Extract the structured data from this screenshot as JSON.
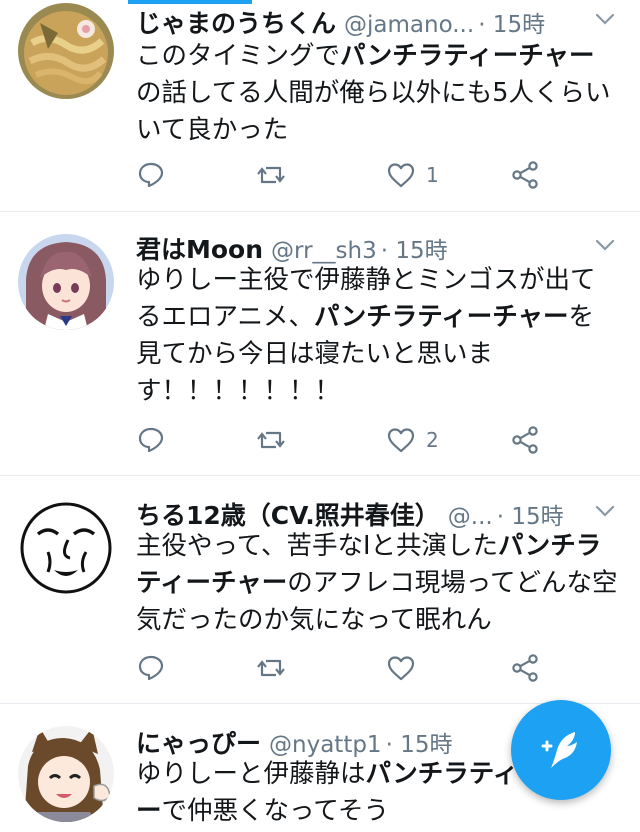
{
  "tweets": [
    {
      "name": "じゃまのうちくん",
      "handle": "@jamano...",
      "time": "· 15時",
      "text": [
        "このタイミングで",
        "パンチラティーチャー",
        "の話してる人間が俺ら以外にも5人くらいいて良かった"
      ],
      "reply_count": "",
      "retweet_count": "",
      "like_count": "1",
      "avatar_icon": "food-bowl-avatar"
    },
    {
      "name": "君はMoon",
      "handle": "@rr__sh3",
      "time": "· 15時",
      "text": [
        "ゆりしー主役で伊藤静とミンゴスが出てるエロアニメ、",
        "パンチラティーチャー",
        "を見てから今日は寝たいと思います！！！！！！！"
      ],
      "reply_count": "",
      "retweet_count": "",
      "like_count": "2",
      "avatar_icon": "anime-girl-avatar"
    },
    {
      "name": "ちる12歳（CV.照井春佳）",
      "handle": "@...",
      "time": "· 15時",
      "text": [
        "主役やって、苦手なIと共演した",
        "パンチラティーチャー",
        "のアフレコ現場ってどんな空気だったのか気になって眠れん"
      ],
      "reply_count": "",
      "retweet_count": "",
      "like_count": "",
      "avatar_icon": "face-drawing-avatar"
    },
    {
      "name": "にゃっぴー",
      "handle": "@nyattp1",
      "time": "· 15時",
      "text": [
        "ゆりしーと伊藤静は",
        "パンチラティーチャー",
        "で仲悪くなってそう"
      ],
      "avatar_icon": "anime-catgirl-avatar"
    }
  ],
  "colors": {
    "accent": "#1da1f2",
    "secondary_text": "#657786",
    "divider": "#e6ecf0"
  },
  "compose_button_icon": "compose-feather-icon"
}
